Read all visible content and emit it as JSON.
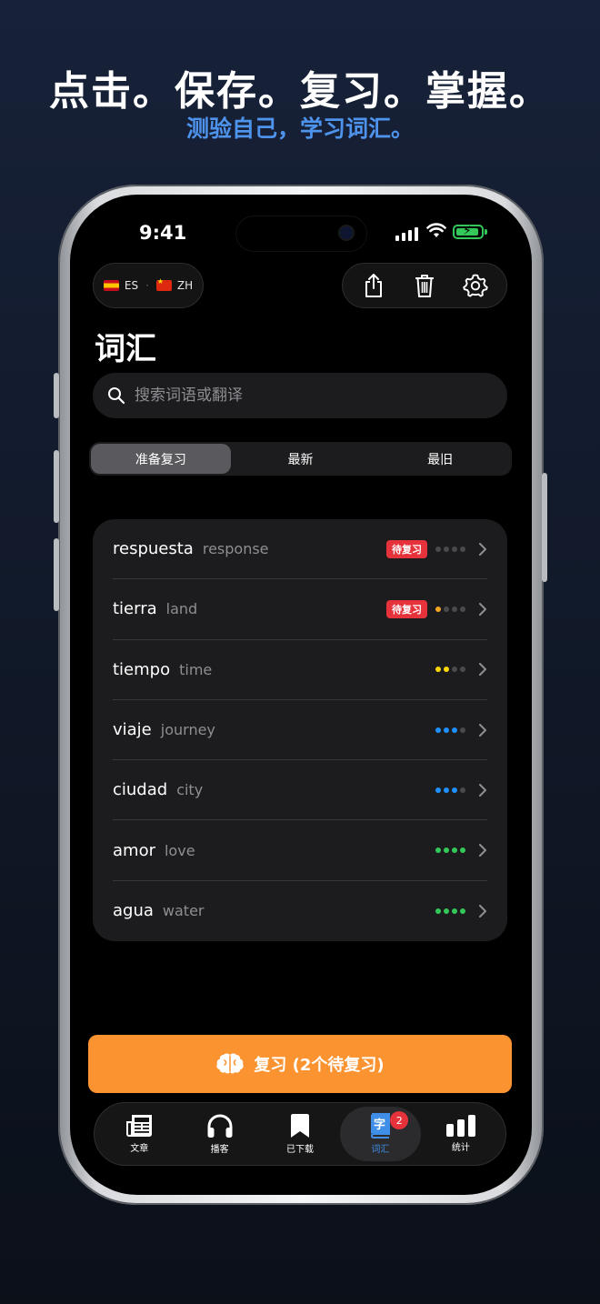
{
  "promo": {
    "headline": "点击。保存。复习。掌握。",
    "subline": "测验自己，学习词汇。"
  },
  "status_bar": {
    "time": "9:41"
  },
  "header": {
    "source_lang": "ES",
    "target_lang": "ZH",
    "title": "词汇"
  },
  "search": {
    "placeholder": "搜索词语或翻译"
  },
  "segments": [
    {
      "label": "准备复习",
      "active": true
    },
    {
      "label": "最新",
      "active": false
    },
    {
      "label": "最旧",
      "active": false
    }
  ],
  "words": [
    {
      "word": "respuesta",
      "translation": "response",
      "badge": "待复习",
      "level": 0,
      "dot_color": "#4a4a4e"
    },
    {
      "word": "tierra",
      "translation": "land",
      "badge": "待复习",
      "level": 1,
      "dot_color": "#f5a623"
    },
    {
      "word": "tiempo",
      "translation": "time",
      "badge": "",
      "level": 2,
      "dot_color": "#ffd60a"
    },
    {
      "word": "viaje",
      "translation": "journey",
      "badge": "",
      "level": 3,
      "dot_color": "#1e90ff"
    },
    {
      "word": "ciudad",
      "translation": "city",
      "badge": "",
      "level": 3,
      "dot_color": "#1e90ff"
    },
    {
      "word": "amor",
      "translation": "love",
      "badge": "",
      "level": 4,
      "dot_color": "#34c759"
    },
    {
      "word": "agua",
      "translation": "water",
      "badge": "",
      "level": 4,
      "dot_color": "#34c759"
    }
  ],
  "review_button": {
    "label": "复习 (2个待复习)"
  },
  "tabs": [
    {
      "label": "文章",
      "icon": "newspaper-icon",
      "active": false
    },
    {
      "label": "播客",
      "icon": "headphones-icon",
      "active": false
    },
    {
      "label": "已下载",
      "icon": "bookmark-icon",
      "active": false
    },
    {
      "label": "词汇",
      "icon": "vocabulary-book-icon",
      "active": true,
      "badge": "2"
    },
    {
      "label": "统计",
      "icon": "bar-chart-icon",
      "active": false
    }
  ],
  "colors": {
    "accent_orange": "#fb9330",
    "accent_blue": "#3f8fe8",
    "badge_red": "#e5323b"
  }
}
